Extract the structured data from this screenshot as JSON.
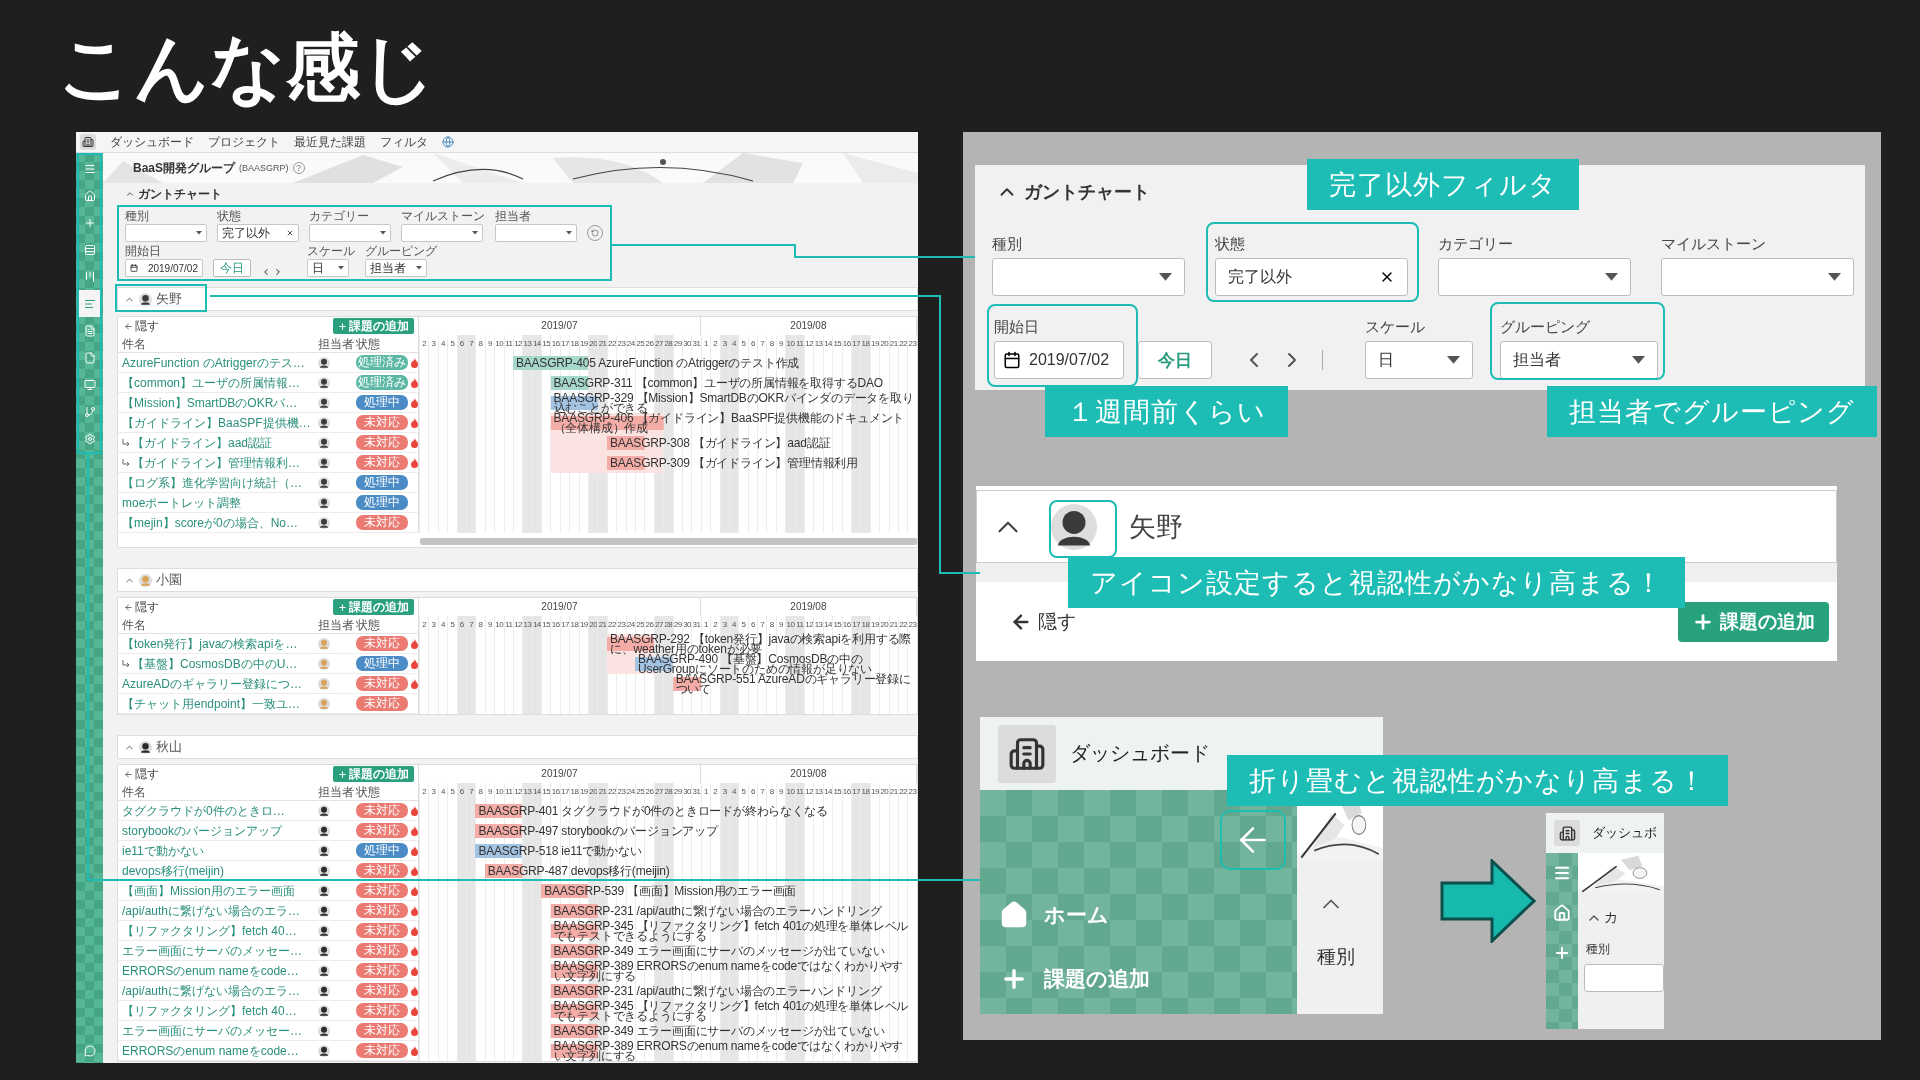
{
  "slide_title": "こんな感じ",
  "app": {
    "nav": [
      "ダッシュボード",
      "プロジェクト",
      "最近見た課題",
      "フィルタ"
    ],
    "sidebar": [
      {
        "kind": "menu",
        "selected": false
      },
      {
        "kind": "home",
        "selected": false
      },
      {
        "kind": "add",
        "selected": false
      },
      {
        "kind": "issues",
        "selected": false
      },
      {
        "kind": "board",
        "selected": false
      },
      {
        "kind": "gantt",
        "selected": true
      },
      {
        "kind": "document",
        "selected": false
      },
      {
        "kind": "wiki",
        "selected": false
      },
      {
        "kind": "monitor",
        "selected": false
      },
      {
        "kind": "git",
        "selected": false
      },
      {
        "kind": "settings",
        "selected": false
      }
    ],
    "project": {
      "name": "BaaS開発グループ",
      "key": "(BAASGRP)",
      "help": "?"
    },
    "gantt_title": "ガントチャート",
    "filters": [
      {
        "label": "種別",
        "kind": "select"
      },
      {
        "label": "状態",
        "kind": "clearable",
        "value": "完了以外"
      },
      {
        "label": "カテゴリー",
        "kind": "select"
      },
      {
        "label": "マイルストーン",
        "kind": "select"
      },
      {
        "label": "担当者",
        "kind": "select"
      }
    ],
    "start_date": {
      "label": "開始日",
      "value": "2019/07/02"
    },
    "today": "今日",
    "scale": {
      "label": "スケール",
      "value": "日"
    },
    "grouping": {
      "label": "グルーピング",
      "value": "担当者"
    },
    "groups": [
      {
        "name": "矢野",
        "expanded": true,
        "hide": "隠す",
        "add": "課題の追加",
        "columns": [
          "件名",
          "担当者",
          "状態"
        ],
        "scrollbar": true,
        "months": [
          {
            "label": "2019/07",
            "days": [
              {
                "label": "2",
                "weekend": false
              },
              {
                "label": "3",
                "weekend": false
              },
              {
                "label": "4",
                "weekend": false
              },
              {
                "label": "5",
                "weekend": false
              },
              {
                "label": "6",
                "weekend": true
              },
              {
                "label": "7",
                "weekend": true
              },
              {
                "label": "8",
                "weekend": false
              },
              {
                "label": "9",
                "weekend": false
              },
              {
                "label": "10",
                "weekend": false
              },
              {
                "label": "11",
                "weekend": false
              },
              {
                "label": "12",
                "weekend": false
              },
              {
                "label": "13",
                "weekend": true
              },
              {
                "label": "14",
                "weekend": true
              },
              {
                "label": "15",
                "weekend": false
              },
              {
                "label": "16",
                "weekend": false
              },
              {
                "label": "17",
                "weekend": false
              },
              {
                "label": "18",
                "weekend": false
              },
              {
                "label": "19",
                "weekend": false
              },
              {
                "label": "20",
                "weekend": true
              },
              {
                "label": "21",
                "weekend": true
              },
              {
                "label": "22",
                "weekend": false
              },
              {
                "label": "23",
                "weekend": false
              },
              {
                "label": "24",
                "weekend": false
              },
              {
                "label": "25",
                "weekend": false
              },
              {
                "label": "26",
                "weekend": false
              },
              {
                "label": "27",
                "weekend": true
              },
              {
                "label": "28",
                "weekend": true
              },
              {
                "label": "29",
                "weekend": false
              },
              {
                "label": "30",
                "weekend": false
              },
              {
                "label": "31",
                "weekend": false
              }
            ]
          },
          {
            "label": "2019/08",
            "days": [
              {
                "label": "1",
                "weekend": false
              },
              {
                "label": "2",
                "weekend": false
              },
              {
                "label": "3",
                "weekend": true
              },
              {
                "label": "4",
                "weekend": true
              },
              {
                "label": "5",
                "weekend": false
              },
              {
                "label": "6",
                "weekend": false
              },
              {
                "label": "7",
                "weekend": false
              },
              {
                "label": "8",
                "weekend": false
              },
              {
                "label": "9",
                "weekend": false
              },
              {
                "label": "10",
                "weekend": true
              },
              {
                "label": "11",
                "weekend": true
              },
              {
                "label": "12",
                "weekend": false
              },
              {
                "label": "13",
                "weekend": false
              },
              {
                "label": "14",
                "weekend": false
              },
              {
                "label": "15",
                "weekend": false
              },
              {
                "label": "16",
                "weekend": false
              },
              {
                "label": "17",
                "weekend": true
              },
              {
                "label": "18",
                "weekend": true
              },
              {
                "label": "19",
                "weekend": false
              },
              {
                "label": "20",
                "weekend": false
              },
              {
                "label": "21",
                "weekend": false
              },
              {
                "label": "22",
                "weekend": false
              },
              {
                "label": "23",
                "weekend": false
              }
            ]
          }
        ],
        "rows": [
          {
            "name": "AzureFunction のAtriggerのテス…",
            "subtask": false,
            "status": {
              "label": "処理済み",
              "kind": "done"
            },
            "hot": true,
            "bar": "BAASGRP-405 AzureFunction のAtriggerのテスト作成"
          },
          {
            "name": "【common】ユーザの所属情報…",
            "subtask": false,
            "status": {
              "label": "処理済み",
              "kind": "done"
            },
            "hot": true,
            "bar": "BAASGRP-311 【common】ユーザの所属情報を取得するDAO"
          },
          {
            "name": "【Mission】SmartDBのOKRバ…",
            "subtask": false,
            "status": {
              "label": "処理中",
              "kind": "doing"
            },
            "hot": true,
            "bar": "BAASGRP-329 【Mission】SmartDBのOKRバインダのデータを取り込むことができる"
          },
          {
            "name": "【ガイドライン】BaaSPF提供機…",
            "subtask": false,
            "status": {
              "label": "未対応",
              "kind": "open"
            },
            "hot": true,
            "bar": "BAASGRP-406 【ガイドライン】BaaSPF提供機能のドキュメント（全体構成）作成"
          },
          {
            "name": "【ガイドライン】aad認証",
            "subtask": true,
            "status": {
              "label": "未対応",
              "kind": "open"
            },
            "hot": true,
            "bar": "BAASGRP-308 【ガイドライン】aad認証"
          },
          {
            "name": "【ガイドライン】管理情報利…",
            "subtask": true,
            "status": {
              "label": "未対応",
              "kind": "open"
            },
            "hot": true,
            "bar": "BAASGRP-309 【ガイドライン】管理情報利用"
          },
          {
            "name": "【ログ系】進化学習向け統計（…",
            "subtask": false,
            "status": {
              "label": "処理中",
              "kind": "doing"
            },
            "hot": false
          },
          {
            "name": "moeポートレット調整",
            "subtask": false,
            "status": {
              "label": "処理中",
              "kind": "doing"
            },
            "hot": false
          },
          {
            "name": "【mejin】scoreが0の場合、No…",
            "subtask": false,
            "status": {
              "label": "未対応",
              "kind": "open"
            },
            "hot": false
          }
        ]
      },
      {
        "name": "小園",
        "expanded": true,
        "hide": "隠す",
        "add": "課題の追加",
        "columns": [
          "件名",
          "担当者",
          "状態"
        ],
        "scrollbar": false,
        "months": [
          {
            "label": "2019/07",
            "days": [
              {
                "label": "2",
                "weekend": false
              },
              {
                "label": "3",
                "weekend": false
              },
              {
                "label": "4",
                "weekend": false
              },
              {
                "label": "5",
                "weekend": false
              },
              {
                "label": "6",
                "weekend": true
              },
              {
                "label": "7",
                "weekend": true
              },
              {
                "label": "8",
                "weekend": false
              },
              {
                "label": "9",
                "weekend": false
              },
              {
                "label": "10",
                "weekend": false
              },
              {
                "label": "11",
                "weekend": false
              },
              {
                "label": "12",
                "weekend": false
              },
              {
                "label": "13",
                "weekend": true
              },
              {
                "label": "14",
                "weekend": true
              },
              {
                "label": "15",
                "weekend": false
              },
              {
                "label": "16",
                "weekend": false
              },
              {
                "label": "17",
                "weekend": false
              },
              {
                "label": "18",
                "weekend": false
              },
              {
                "label": "19",
                "weekend": false
              },
              {
                "label": "20",
                "weekend": true
              },
              {
                "label": "21",
                "weekend": true
              },
              {
                "label": "22",
                "weekend": false
              },
              {
                "label": "23",
                "weekend": false
              },
              {
                "label": "24",
                "weekend": false
              },
              {
                "label": "25",
                "weekend": false
              },
              {
                "label": "26",
                "weekend": false
              },
              {
                "label": "27",
                "weekend": true
              },
              {
                "label": "28",
                "weekend": true
              },
              {
                "label": "29",
                "weekend": false
              },
              {
                "label": "30",
                "weekend": false
              },
              {
                "label": "31",
                "weekend": false
              }
            ]
          },
          {
            "label": "2019/08",
            "days": [
              {
                "label": "1",
                "weekend": false
              },
              {
                "label": "2",
                "weekend": false
              },
              {
                "label": "3",
                "weekend": true
              },
              {
                "label": "4",
                "weekend": true
              },
              {
                "label": "5",
                "weekend": false
              },
              {
                "label": "6",
                "weekend": false
              },
              {
                "label": "7",
                "weekend": false
              },
              {
                "label": "8",
                "weekend": false
              },
              {
                "label": "9",
                "weekend": false
              },
              {
                "label": "10",
                "weekend": true
              },
              {
                "label": "11",
                "weekend": true
              },
              {
                "label": "12",
                "weekend": false
              },
              {
                "label": "13",
                "weekend": false
              },
              {
                "label": "14",
                "weekend": false
              },
              {
                "label": "15",
                "weekend": false
              },
              {
                "label": "16",
                "weekend": false
              },
              {
                "label": "17",
                "weekend": true
              },
              {
                "label": "18",
                "weekend": true
              },
              {
                "label": "19",
                "weekend": false
              },
              {
                "label": "20",
                "weekend": false
              },
              {
                "label": "21",
                "weekend": false
              },
              {
                "label": "22",
                "weekend": false
              },
              {
                "label": "23",
                "weekend": false
              }
            ]
          }
        ],
        "rows": [
          {
            "name": "【token発行】javaの検索apiを…",
            "subtask": false,
            "status": {
              "label": "未対応",
              "kind": "open"
            },
            "hot": true,
            "bar": "BAASGRP-292 【token発行】javaの検索apiを利用する際に、weather用のtokenが必要"
          },
          {
            "name": "【基盤】CosmosDBの中のU…",
            "subtask": true,
            "status": {
              "label": "処理中",
              "kind": "doing"
            },
            "hot": true,
            "bar": "BAASGRP-490 【基盤】CosmosDBの中のUserGroupにソートのための情報が足りない"
          },
          {
            "name": "AzureADのギャラリー登録につ…",
            "subtask": false,
            "status": {
              "label": "未対応",
              "kind": "open"
            },
            "hot": true,
            "bar": "BAASGRP-551 AzureADのギャラリー登録について"
          },
          {
            "name": "【チャット用endpoint】一致ユ…",
            "subtask": false,
            "status": {
              "label": "未対応",
              "kind": "open"
            },
            "hot": false
          }
        ]
      },
      {
        "name": "秋山",
        "expanded": true,
        "hide": "隠す",
        "add": "課題の追加",
        "columns": [
          "件名",
          "担当者",
          "状態"
        ],
        "scrollbar": false,
        "months": [
          {
            "label": "2019/07",
            "days": [
              {
                "label": "2",
                "weekend": false
              },
              {
                "label": "3",
                "weekend": false
              },
              {
                "label": "4",
                "weekend": false
              },
              {
                "label": "5",
                "weekend": false
              },
              {
                "label": "6",
                "weekend": true
              },
              {
                "label": "7",
                "weekend": true
              },
              {
                "label": "8",
                "weekend": false
              },
              {
                "label": "9",
                "weekend": false
              },
              {
                "label": "10",
                "weekend": false
              },
              {
                "label": "11",
                "weekend": false
              },
              {
                "label": "12",
                "weekend": false
              },
              {
                "label": "13",
                "weekend": true
              },
              {
                "label": "14",
                "weekend": true
              },
              {
                "label": "15",
                "weekend": false
              },
              {
                "label": "16",
                "weekend": false
              },
              {
                "label": "17",
                "weekend": false
              },
              {
                "label": "18",
                "weekend": false
              },
              {
                "label": "19",
                "weekend": false
              },
              {
                "label": "20",
                "weekend": true
              },
              {
                "label": "21",
                "weekend": true
              },
              {
                "label": "22",
                "weekend": false
              },
              {
                "label": "23",
                "weekend": false
              },
              {
                "label": "24",
                "weekend": false
              },
              {
                "label": "25",
                "weekend": false
              },
              {
                "label": "26",
                "weekend": false
              },
              {
                "label": "27",
                "weekend": true
              },
              {
                "label": "28",
                "weekend": true
              },
              {
                "label": "29",
                "weekend": false
              },
              {
                "label": "30",
                "weekend": false
              },
              {
                "label": "31",
                "weekend": false
              }
            ]
          },
          {
            "label": "2019/08",
            "days": [
              {
                "label": "1",
                "weekend": false
              },
              {
                "label": "2",
                "weekend": false
              },
              {
                "label": "3",
                "weekend": true
              },
              {
                "label": "4",
                "weekend": true
              },
              {
                "label": "5",
                "weekend": false
              },
              {
                "label": "6",
                "weekend": false
              },
              {
                "label": "7",
                "weekend": false
              },
              {
                "label": "8",
                "weekend": false
              },
              {
                "label": "9",
                "weekend": false
              },
              {
                "label": "10",
                "weekend": true
              },
              {
                "label": "11",
                "weekend": true
              },
              {
                "label": "12",
                "weekend": false
              },
              {
                "label": "13",
                "weekend": false
              },
              {
                "label": "14",
                "weekend": false
              },
              {
                "label": "15",
                "weekend": false
              },
              {
                "label": "16",
                "weekend": false
              },
              {
                "label": "17",
                "weekend": true
              },
              {
                "label": "18",
                "weekend": true
              },
              {
                "label": "19",
                "weekend": false
              },
              {
                "label": "20",
                "weekend": false
              },
              {
                "label": "21",
                "weekend": false
              },
              {
                "label": "22",
                "weekend": false
              },
              {
                "label": "23",
                "weekend": false
              }
            ]
          }
        ],
        "rows": [
          {
            "name": "タグクラウドが0件のときロ…",
            "subtask": false,
            "status": {
              "label": "未対応",
              "kind": "open"
            },
            "hot": true,
            "bar": "BAASGRP-401 タグクラウドが0件のときロードが終わらなくなる"
          },
          {
            "name": "storybookのバージョンアップ",
            "subtask": false,
            "status": {
              "label": "未対応",
              "kind": "open"
            },
            "hot": true,
            "bar": "BAASGRP-497 storybookのバージョンアップ"
          },
          {
            "name": "ie11で動かない",
            "subtask": false,
            "status": {
              "label": "処理中",
              "kind": "doing"
            },
            "hot": true,
            "bar": "BAASGRP-518 ie11で動かない"
          },
          {
            "name": "devops移行(meijin)",
            "subtask": false,
            "status": {
              "label": "未対応",
              "kind": "open"
            },
            "hot": true,
            "bar": "BAASGRP-487 devops移行(meijin)"
          },
          {
            "name": "【画面】Mission用のエラー画面",
            "subtask": false,
            "status": {
              "label": "未対応",
              "kind": "open"
            },
            "hot": true,
            "bar": "BAASGRP-539 【画面】Mission用のエラー画面"
          },
          {
            "name": "/api/authに繋げない場合のエラ…",
            "subtask": false,
            "status": {
              "label": "未対応",
              "kind": "open"
            },
            "hot": true,
            "bar": "BAASGRP-231 /api/authに繋げない場合のエラーハンドリング"
          },
          {
            "name": "【リファクタリング】fetch 40…",
            "subtask": false,
            "status": {
              "label": "未対応",
              "kind": "open"
            },
            "hot": true,
            "bar": "BAASGRP-345 【リファクタリング】fetch 401の処理を単体レベルでもテストできるようにする"
          },
          {
            "name": "エラー画面にサーバのメッセー…",
            "subtask": false,
            "status": {
              "label": "未対応",
              "kind": "open"
            },
            "hot": true,
            "bar": "BAASGRP-349 エラー画面にサーバのメッセージが出ていない"
          },
          {
            "name": "ERRORSのenum nameをcode…",
            "subtask": false,
            "status": {
              "label": "未対応",
              "kind": "open"
            },
            "hot": true,
            "bar": "BAASGRP-389 ERRORSのenum nameをcodeではなくわかりやすい文字列にする"
          },
          {
            "name": "/api/authに繋げない場合のエラ…",
            "subtask": false,
            "status": {
              "label": "未対応",
              "kind": "open"
            },
            "hot": true,
            "bar": "BAASGRP-231 /api/authに繋げない場合のエラーハンドリング"
          },
          {
            "name": "【リファクタリング】fetch 40…",
            "subtask": false,
            "status": {
              "label": "未対応",
              "kind": "open"
            },
            "hot": true,
            "bar": "BAASGRP-345 【リファクタリング】fetch 401の処理を単体レベルでもテストできるようにする"
          },
          {
            "name": "エラー画面にサーバのメッセー…",
            "subtask": false,
            "status": {
              "label": "未対応",
              "kind": "open"
            },
            "hot": true,
            "bar": "BAASGRP-349 エラー画面にサーバのメッセージが出ていない"
          },
          {
            "name": "ERRORSのenum nameをcode…",
            "subtask": false,
            "status": {
              "label": "未対応",
              "kind": "open"
            },
            "hot": true,
            "bar": "BAASGRP-389 ERRORSのenum nameをcodeではなくわかりやすい文字列にする"
          }
        ]
      }
    ]
  },
  "filter_zoom": {
    "title": "ガントチャート",
    "fields": [
      {
        "label": "種別",
        "kind": "select"
      },
      {
        "label": "状態",
        "kind": "clearable",
        "value": "完了以外"
      },
      {
        "label": "カテゴリー",
        "kind": "select"
      },
      {
        "label": "マイルストーン",
        "kind": "select"
      }
    ],
    "start_date": {
      "label": "開始日",
      "value": "2019/07/02"
    },
    "today": "今日",
    "scale": {
      "label": "スケール",
      "value": "日"
    },
    "grouping": {
      "label": "グルーピング",
      "value": "担当者"
    }
  },
  "group_zoom": {
    "name": "矢野",
    "expanded": true,
    "hide": "隠す",
    "add": "課題の追加"
  },
  "sidebar_zoom": {
    "nav": [
      "ダッシュボード"
    ],
    "items": [
      {
        "kind": "home",
        "label": "ホーム"
      },
      {
        "kind": "add",
        "label": "課題の追加"
      }
    ],
    "chevron_label": "種別"
  },
  "collapsed_zoom": {
    "nav": "ダッシュボ",
    "items": [
      {
        "kind": "menu"
      },
      {
        "kind": "home"
      },
      {
        "kind": "add"
      }
    ],
    "heading": "カ",
    "label": "種別"
  },
  "notes": [
    "完了以外フィルタ",
    "１週間前くらい",
    "担当者でグルーピング",
    "アイコン設定すると視認性がかなり高まる！",
    "折り畳むと視認性がかなり高まる！"
  ]
}
